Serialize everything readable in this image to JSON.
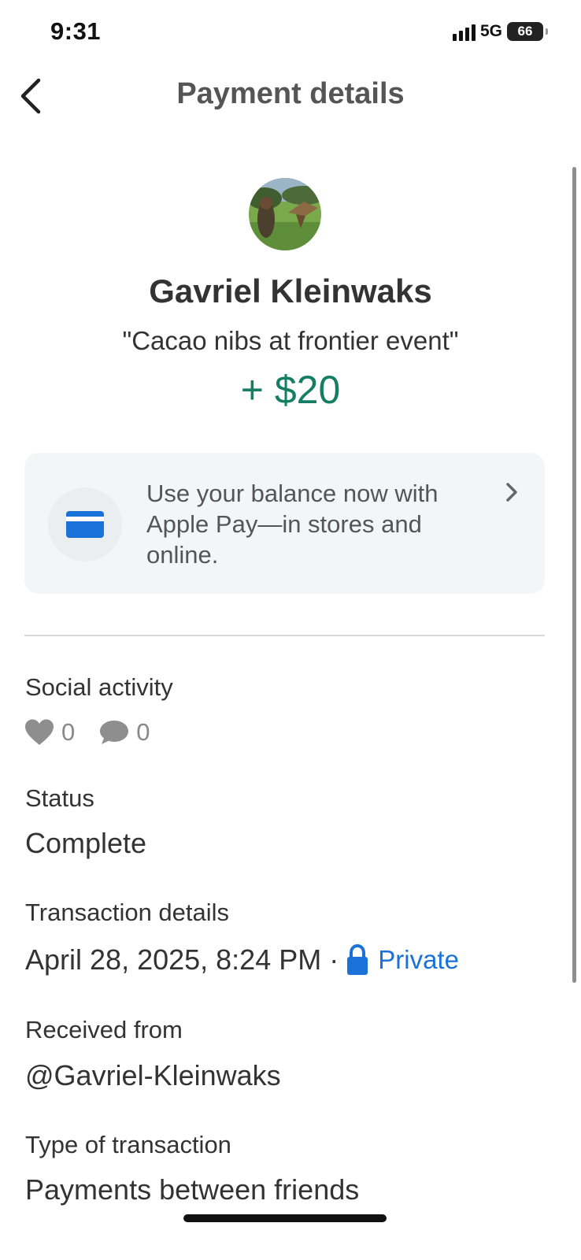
{
  "status_bar": {
    "time": "9:31",
    "network": "5G",
    "battery": "66"
  },
  "header": {
    "title": "Payment details",
    "back_icon": "chevron-left-icon"
  },
  "payment": {
    "name": "Gavriel Kleinwaks",
    "note": "\"Cacao nibs at frontier event\"",
    "amount": "+ $20",
    "amount_color": "#147d64"
  },
  "promo": {
    "text": "Use your balance now with Apple Pay—in stores and online.",
    "icon": "card-icon",
    "icon_color": "#1a72d9"
  },
  "social": {
    "label": "Social activity",
    "likes": "0",
    "comments": "0"
  },
  "status": {
    "label": "Status",
    "value": "Complete"
  },
  "transaction": {
    "label": "Transaction details",
    "date": "April 28, 2025, 8:24 PM",
    "separator": "·",
    "privacy": "Private",
    "privacy_color": "#1a72d9"
  },
  "received_from": {
    "label": "Received from",
    "value": "@Gavriel-Kleinwaks"
  },
  "type": {
    "label": "Type of transaction",
    "value": "Payments between friends"
  }
}
